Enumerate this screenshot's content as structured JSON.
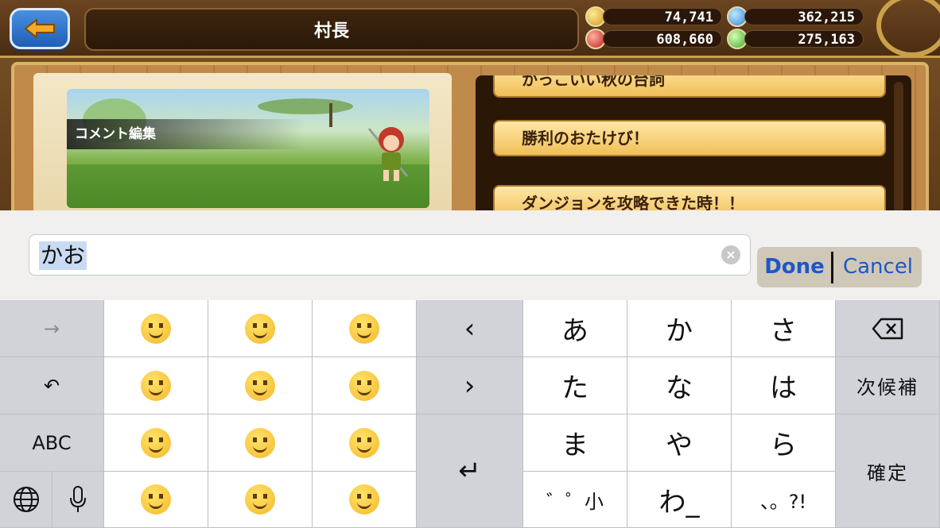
{
  "header": {
    "title": "村長",
    "currencies": [
      {
        "icon": "gold-coin-icon",
        "value": "74,741"
      },
      {
        "icon": "blue-gem-icon",
        "value": "362,215"
      },
      {
        "icon": "red-gem-icon",
        "value": "608,660"
      },
      {
        "icon": "green-gem-icon",
        "value": "275,163"
      }
    ]
  },
  "profile": {
    "banner_label": "コメント編集"
  },
  "comment_list": {
    "items": [
      "かっこいい秋の台詞",
      "勝利のおたけび！",
      "ダンジョンを攻略できた時！！"
    ]
  },
  "input": {
    "value": "かお",
    "done_label": "Done",
    "cancel_label": "Cancel"
  },
  "keyboard": {
    "arrow_right": "→",
    "undo": "↶",
    "abc": "ABC",
    "globe_icon": "globe-icon",
    "mic_icon": "microphone-icon",
    "left_caret": "‹",
    "right_caret": "›",
    "return_symbol": "↵",
    "kana": [
      "あ",
      "か",
      "さ",
      "た",
      "な",
      "は",
      "ま",
      "や",
      "ら",
      "゛゜小",
      "わ_",
      "、。?!"
    ],
    "next_candidate": "次候補",
    "confirm": "確定",
    "emoji": [
      "grinning-face-with-smiling-eyes",
      "grinning-face",
      "smiling-face-with-smiling-eyes",
      "hugging-face",
      "smiling-face",
      "grinning-squinting-face",
      "face-with-tears-of-joy",
      "face-savoring-food",
      "winking-face",
      "slightly-smiling-face",
      "upside-down-face",
      "relieved-face"
    ]
  },
  "colors": {
    "accent_blue": "#1f56c7",
    "wood_dark": "#4a2d12",
    "gold": "#c9a14a"
  }
}
